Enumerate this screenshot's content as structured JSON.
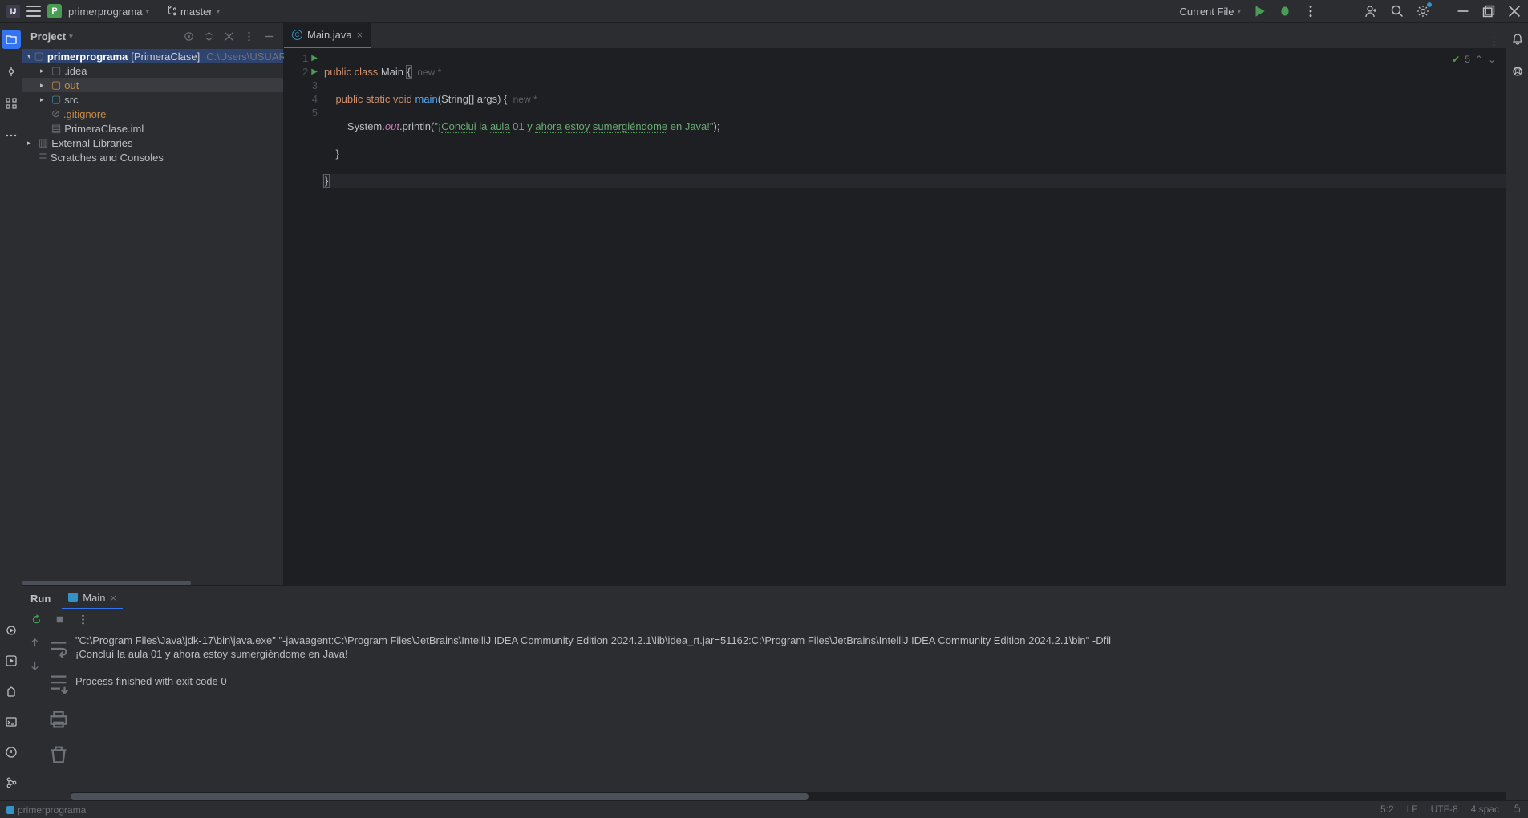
{
  "titlebar": {
    "app_badge": "IJ",
    "project_badge": "P",
    "project_name": "primerprograma",
    "branch": "master",
    "run_config": "Current File"
  },
  "project_panel": {
    "title": "Project",
    "tree": {
      "root_name": "primerprograma",
      "root_alias": "[PrimeraClase]",
      "root_path": "C:\\Users\\USUARIO\\Deskt",
      "idea": ".idea",
      "out": "out",
      "src": "src",
      "gitignore": ".gitignore",
      "iml": "PrimeraClase.iml",
      "ext_lib": "External Libraries",
      "scratches": "Scratches and Consoles"
    }
  },
  "editor": {
    "tab_name": "Main.java",
    "lines": [
      "1",
      "2",
      "3",
      "4",
      "5"
    ],
    "code": {
      "l1_kw1": "public",
      "l1_kw2": "class",
      "l1_cls": "Main",
      "l1_brace": "{",
      "l1_inlay": "new *",
      "l2_kw1": "public",
      "l2_kw2": "static",
      "l2_kw3": "void",
      "l2_method": "main",
      "l2_sig": "(String[] args) {",
      "l2_inlay": "new *",
      "l3_sys": "System.",
      "l3_out": "out",
      "l3_print": ".println(",
      "l3_str_open": "\"¡",
      "l3_t1": "Conclui",
      "l3_p1": " la ",
      "l3_t2": "aula",
      "l3_p2": " 01 y ",
      "l3_t3": "ahora",
      "l3_p3": " ",
      "l3_t4": "estoy",
      "l3_p4": " ",
      "l3_t5": "sumergiéndome",
      "l3_p5": " en Java!\"",
      "l3_close": ");",
      "l4": "    }",
      "l5_brace": "}"
    },
    "inspections": "5"
  },
  "run_panel": {
    "title": "Run",
    "tab": "Main",
    "output_line1": "\"C:\\Program Files\\Java\\jdk-17\\bin\\java.exe\" \"-javaagent:C:\\Program Files\\JetBrains\\IntelliJ IDEA Community Edition 2024.2.1\\lib\\idea_rt.jar=51162:C:\\Program Files\\JetBrains\\IntelliJ IDEA Community Edition 2024.2.1\\bin\" -Dfil",
    "output_line2": "¡Concluí la aula 01 y ahora estoy sumergiéndome en Java!",
    "output_line3": "",
    "output_line4": "Process finished with exit code 0"
  },
  "statusbar": {
    "module": "primerprograma",
    "cursor": "5:2",
    "line_sep": "LF",
    "encoding": "UTF-8",
    "indent": "4 spac"
  }
}
